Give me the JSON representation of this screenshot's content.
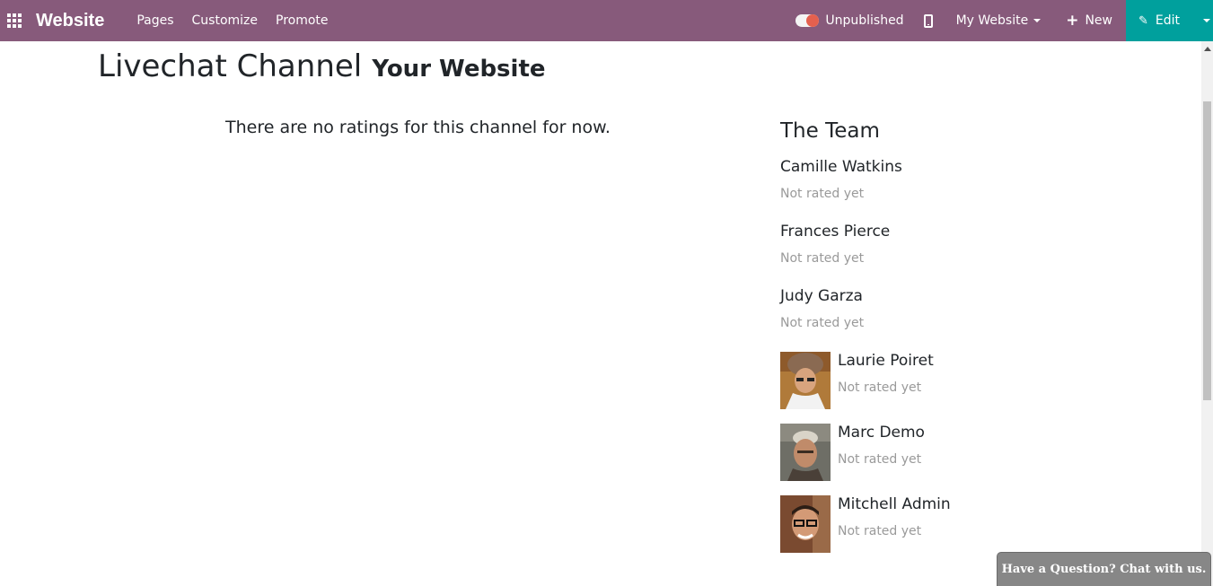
{
  "navbar": {
    "brand": "Website",
    "menu": [
      "Pages",
      "Customize",
      "Promote"
    ],
    "publish_label": "Unpublished",
    "website_dropdown": "My Website",
    "new_label": "New",
    "edit_label": "Edit",
    "colors": {
      "bar": "#875a7b",
      "edit": "#00a09d",
      "toggle_knob": "#e4604e"
    }
  },
  "page": {
    "title": "Livechat Channel",
    "subtitle": "Your Website",
    "no_ratings": "There are no ratings for this channel for now."
  },
  "team": {
    "title": "The Team",
    "members": [
      {
        "name": "Camille Watkins",
        "status": "Not rated yet"
      },
      {
        "name": "Frances Pierce",
        "status": "Not rated yet"
      },
      {
        "name": "Judy Garza",
        "status": "Not rated yet"
      },
      {
        "name": "Laurie Poiret",
        "status": "Not rated yet"
      },
      {
        "name": "Marc Demo",
        "status": "Not rated yet"
      },
      {
        "name": "Mitchell Admin",
        "status": "Not rated yet"
      }
    ]
  },
  "chat": {
    "label": "Have a Question? Chat with us."
  }
}
